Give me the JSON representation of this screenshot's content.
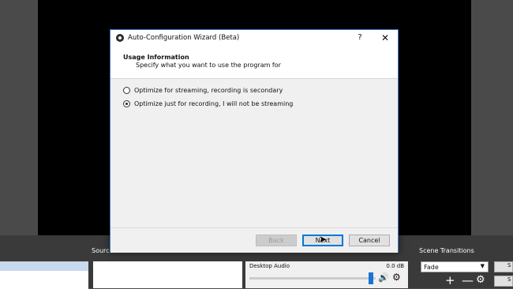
{
  "dialog": {
    "title": "Auto-Configuration Wizard (Beta)",
    "help": "?",
    "close": "✕",
    "header_title": "Usage Information",
    "header_subtitle": "Specify what you want to use the program for",
    "options": [
      {
        "label": "Optimize for streaming, recording is secondary",
        "checked": false
      },
      {
        "label": "Optimize just for recording, I will not be streaming",
        "checked": true
      }
    ],
    "buttons": {
      "back": "Back",
      "next": "Next",
      "cancel": "Cancel"
    }
  },
  "docks": {
    "sources_label": "Sources",
    "mixer": {
      "source_name": "Desktop Audio",
      "level": "0.0 dB",
      "volume_fraction": 0.98
    },
    "transitions_label": "Scene Transitions",
    "transition_value": "Fade",
    "controls": [
      "S",
      "S"
    ]
  },
  "icons": {
    "volume": "speaker-icon",
    "settings": "gear-icon"
  },
  "colors": {
    "accent": "#0078d7",
    "dialog_border": "#3c78c8"
  }
}
